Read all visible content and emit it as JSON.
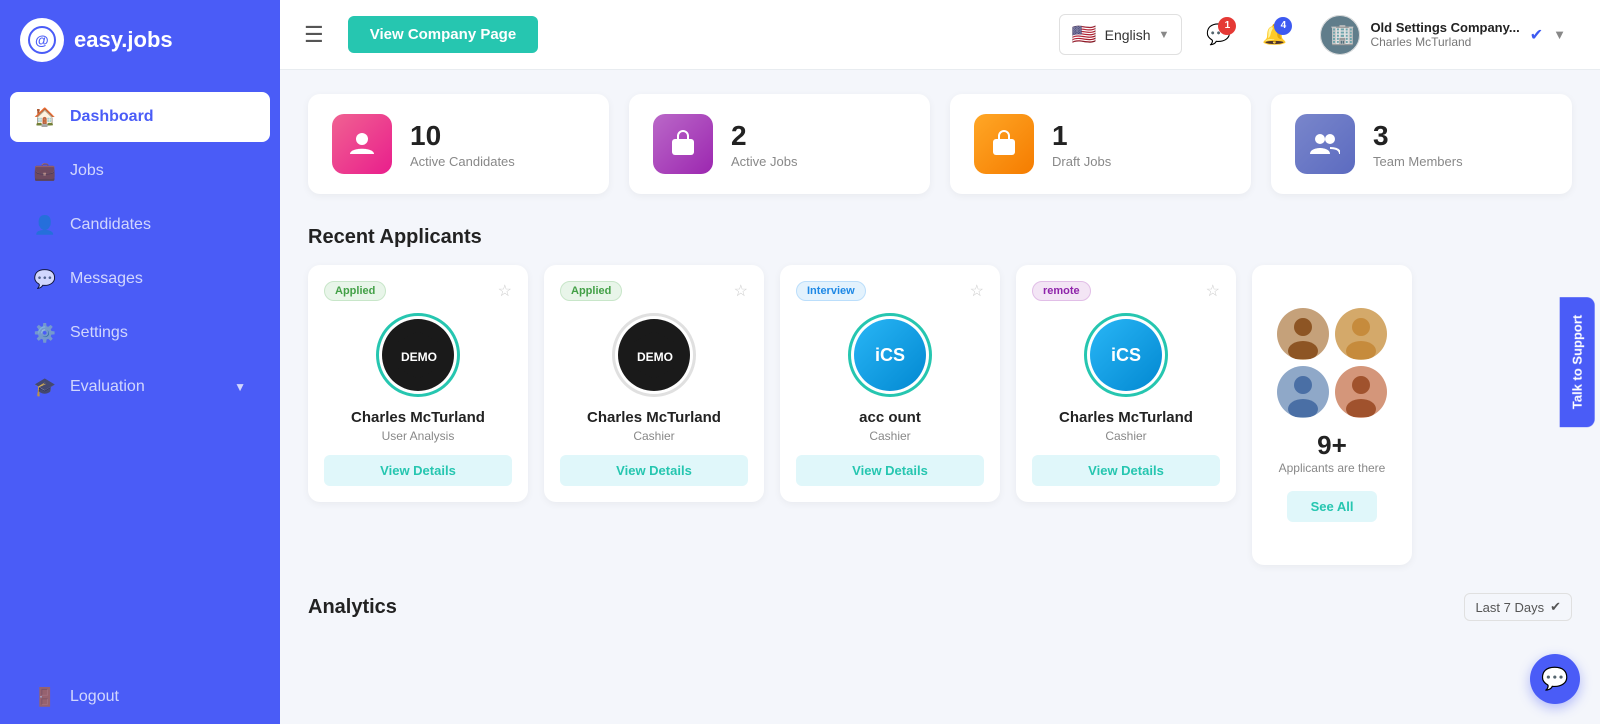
{
  "logo": {
    "icon": "@",
    "text": "easy.jobs"
  },
  "sidebar": {
    "items": [
      {
        "id": "dashboard",
        "label": "Dashboard",
        "icon": "🏠",
        "active": true
      },
      {
        "id": "jobs",
        "label": "Jobs",
        "icon": "💼",
        "active": false
      },
      {
        "id": "candidates",
        "label": "Candidates",
        "icon": "👤",
        "active": false
      },
      {
        "id": "messages",
        "label": "Messages",
        "icon": "💬",
        "active": false
      },
      {
        "id": "settings",
        "label": "Settings",
        "icon": "⚙️",
        "active": false
      },
      {
        "id": "evaluation",
        "label": "Evaluation",
        "icon": "🎓",
        "active": false,
        "hasChevron": true
      }
    ],
    "logout": {
      "label": "Logout",
      "icon": "🚪"
    }
  },
  "header": {
    "menu_icon": "☰",
    "view_company_btn": "View Company Page",
    "language": {
      "flag": "🇺🇸",
      "label": "English"
    },
    "notifications": {
      "messages_count": "1",
      "bell_count": "4"
    },
    "user": {
      "company": "Old Settings Company...",
      "name": "Charles McTurland"
    }
  },
  "stats": [
    {
      "id": "active-candidates",
      "number": "10",
      "label": "Active Candidates",
      "icon": "👤",
      "color": "#f48fb1",
      "gradient": "linear-gradient(135deg, #f06292, #e91e8c)"
    },
    {
      "id": "active-jobs",
      "number": "2",
      "label": "Active Jobs",
      "icon": "💼",
      "color": "#ce93d8",
      "gradient": "linear-gradient(135deg, #ba68c8, #9c27b0)"
    },
    {
      "id": "draft-jobs",
      "number": "1",
      "label": "Draft Jobs",
      "icon": "💼",
      "color": "#ffcc80",
      "gradient": "linear-gradient(135deg, #ffa726, #f57c00)"
    },
    {
      "id": "team-members",
      "number": "3",
      "label": "Team Members",
      "icon": "👥",
      "color": "#9fa8da",
      "gradient": "linear-gradient(135deg, #7986cb, #5c6bc0)"
    }
  ],
  "recent_applicants": {
    "title": "Recent Applicants",
    "cards": [
      {
        "id": "card1",
        "status": "Applied",
        "status_class": "applied",
        "name": "Charles McTurland",
        "role": "User Analysis",
        "avatar_type": "demo",
        "ring_color": "#26c6b0"
      },
      {
        "id": "card2",
        "status": "Applied",
        "status_class": "applied",
        "name": "Charles McTurland",
        "role": "Cashier",
        "avatar_type": "demo",
        "ring_color": "#e0e0e0"
      },
      {
        "id": "card3",
        "status": "Interview",
        "status_class": "interview",
        "name": "acc ount",
        "role": "Cashier",
        "avatar_type": "ics",
        "ring_color": "#26c6b0"
      },
      {
        "id": "card4",
        "status": "remote",
        "status_class": "remote",
        "name": "Charles McTurland",
        "role": "Cashier",
        "avatar_type": "ics",
        "ring_color": "#26c6b0"
      }
    ],
    "view_details_btn": "View Details",
    "more": {
      "count": "9+",
      "label": "Applicants are there",
      "see_all_btn": "See All"
    }
  },
  "analytics": {
    "title": "Analytics",
    "filter": "Last 7 Days"
  },
  "support": {
    "label": "Talk to Support"
  },
  "chat": {
    "icon": "💬"
  }
}
